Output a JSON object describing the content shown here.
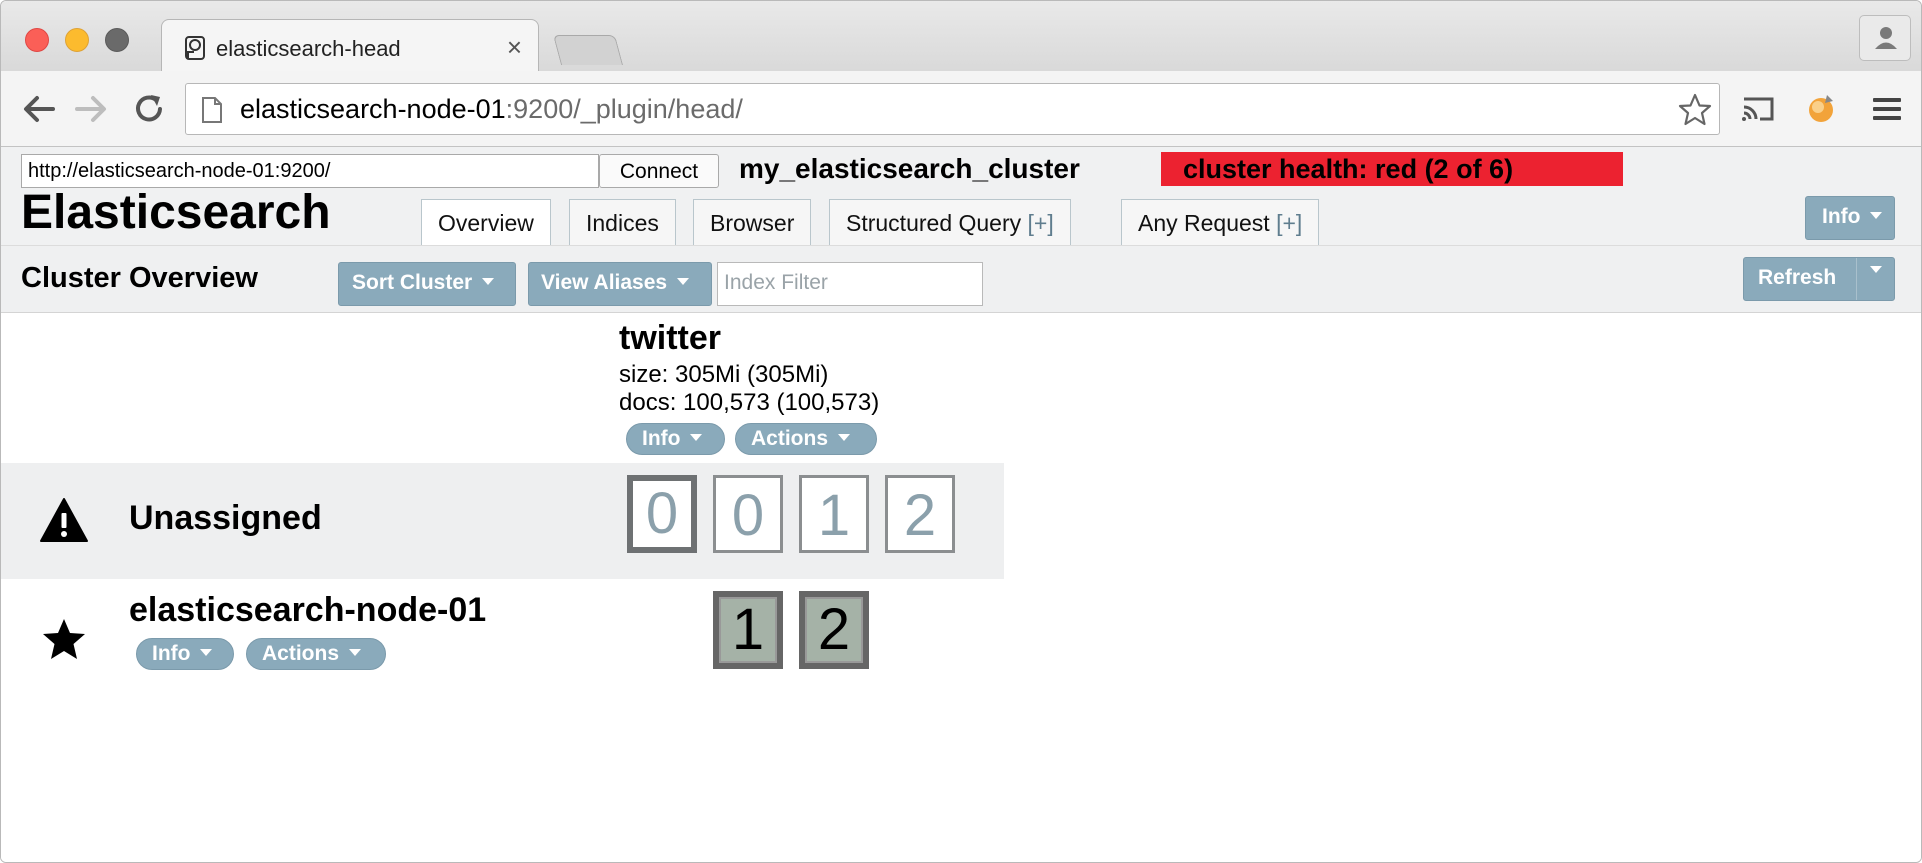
{
  "browser": {
    "tab_title": "elasticsearch-head",
    "tab_close": "×",
    "url_host": "elasticsearch-node-01",
    "url_rest": ":9200/_plugin/head/"
  },
  "head": {
    "connect_url": "http://elasticsearch-node-01:9200/",
    "connect_label": "Connect",
    "cluster_name": "my_elasticsearch_cluster",
    "health": "cluster health: red (2 of 6)",
    "health_color": "#ec2230",
    "brand": "Elasticsearch",
    "tabs": [
      {
        "label": "Overview"
      },
      {
        "label": "Indices"
      },
      {
        "label": "Browser"
      },
      {
        "label": "Structured Query",
        "plus": "[+]"
      },
      {
        "label": "Any Request",
        "plus": "[+]"
      }
    ],
    "info_label": "Info"
  },
  "overview": {
    "title": "Cluster Overview",
    "sort_label": "Sort Cluster",
    "alias_label": "View Aliases",
    "filter_placeholder": "Index Filter",
    "refresh_label": "Refresh"
  },
  "index": {
    "name": "twitter",
    "size": "size: 305Mi (305Mi)",
    "docs": "docs: 100,573 (100,573)",
    "info_label": "Info",
    "actions_label": "Actions"
  },
  "rows": {
    "unassigned": {
      "label": "Unassigned",
      "shards": [
        "0",
        "0",
        "1",
        "2"
      ]
    },
    "node": {
      "label": "elasticsearch-node-01",
      "info_label": "Info",
      "actions_label": "Actions",
      "shards": [
        "1",
        "2"
      ]
    }
  },
  "icons": [
    "favicon-icon",
    "back-icon",
    "forward-icon",
    "reload-icon",
    "page-icon",
    "bookmark-star-icon",
    "cast-icon",
    "extension-icon",
    "menu-icon",
    "profile-icon",
    "warning-icon",
    "star-icon"
  ]
}
